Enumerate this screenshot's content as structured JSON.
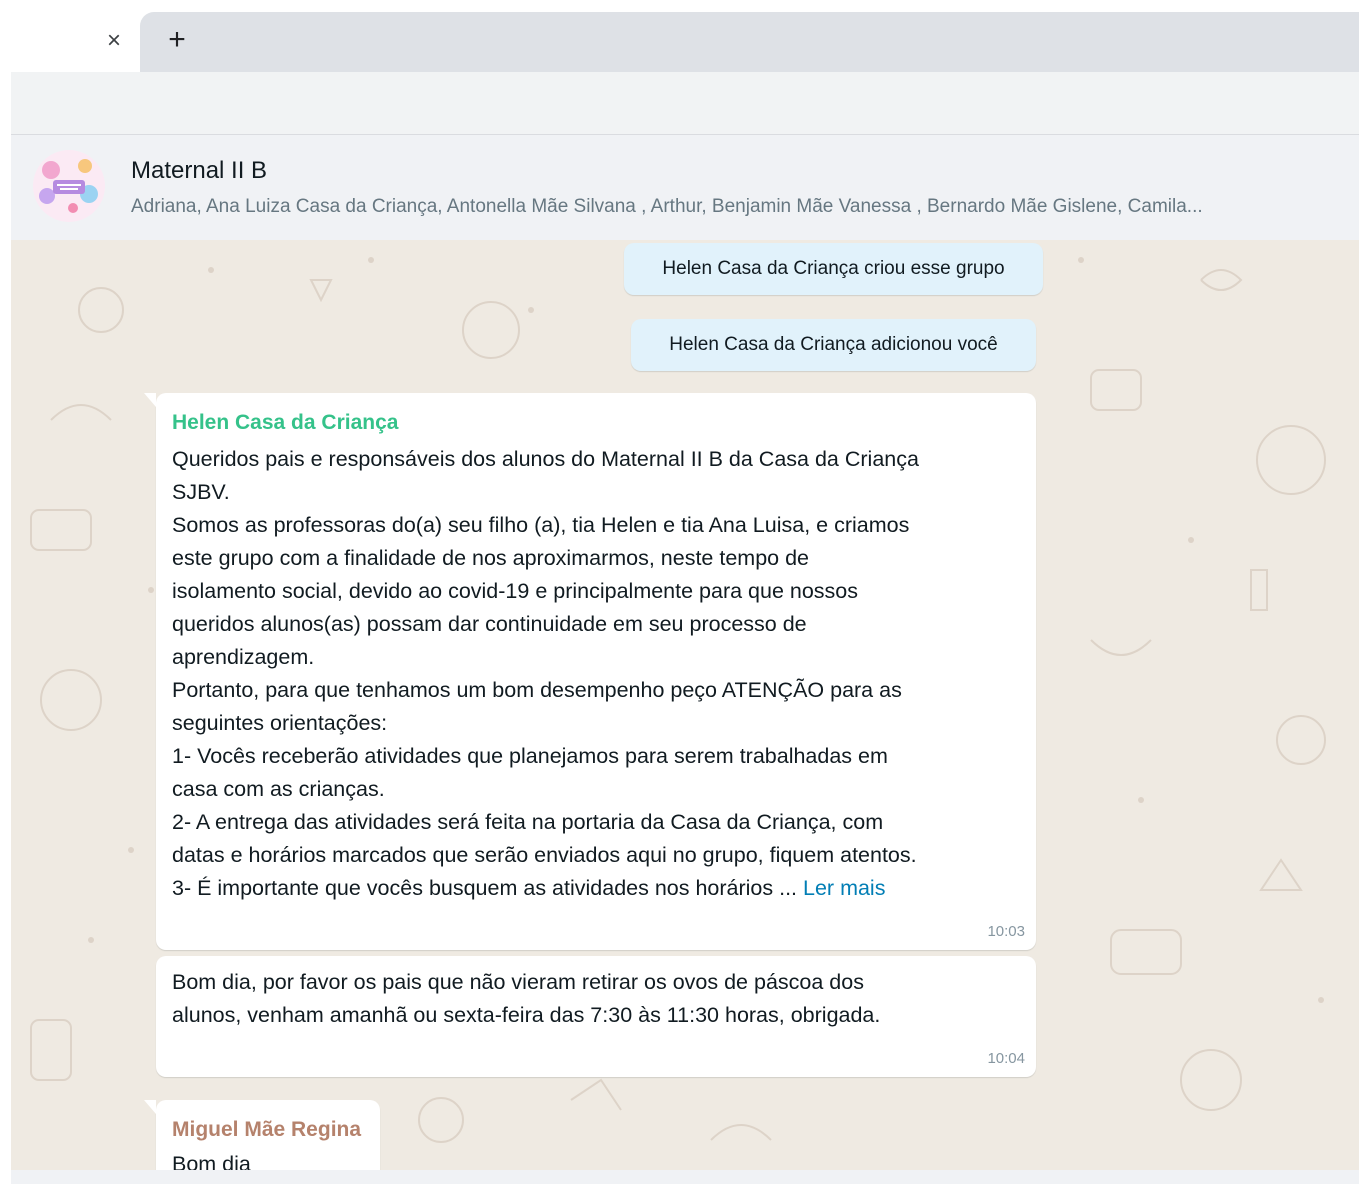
{
  "browser": {
    "tab_close_icon": "close-icon",
    "new_tab_icon": "plus-icon",
    "close_glyph": "×",
    "plus_glyph": "+"
  },
  "header": {
    "group_name": "Maternal II B",
    "members": "Adriana, Ana Luiza Casa da Criança, Antonella Mãe Silvana , Arthur, Benjamin Mãe Vanessa , Bernardo Mãe Gislene, Camila...",
    "avatar_icon": "group-avatar-icon"
  },
  "messages": {
    "system": [
      {
        "text": "Helen Casa da Criança criou esse grupo"
      },
      {
        "text": "Helen Casa da Criança adicionou você"
      }
    ],
    "first": {
      "sender": "Helen Casa da Criança",
      "sender_color": "#35c28a",
      "text": "Queridos pais e responsáveis dos alunos do Maternal II B da Casa da Criança\nSJBV.\nSomos as professoras do(a) seu filho (a), tia Helen e tia Ana Luisa, e criamos\neste grupo com a finalidade de nos aproximarmos, neste tempo de\nisolamento social, devido ao covid-19 e principalmente para que nossos\nqueridos alunos(as) possam dar continuidade em seu processo de\naprendizagem.\nPortanto, para que tenhamos um bom desempenho peço ATENÇÃO para as\nseguintes orientações:\n1- Vocês receberão atividades que planejamos para serem trabalhadas em\ncasa com as crianças.\n2- A entrega das atividades será feita na portaria da Casa da Criança, com\ndatas e horários marcados que serão enviados aqui no grupo, fiquem atentos.\n3- É importante que vocês busquem as atividades nos horários ... ",
      "read_more": "Ler mais",
      "time": "10:03"
    },
    "second": {
      "text": "Bom dia, por favor os pais que não vieram retirar os ovos de páscoa dos\nalunos, venham amanhã ou sexta-feira das 7:30 às 11:30 horas, obrigada.",
      "time": "10:04"
    },
    "third": {
      "sender": "Miguel Mãe Regina",
      "sender_color": "#b5826c",
      "text": "Bom dia"
    }
  }
}
